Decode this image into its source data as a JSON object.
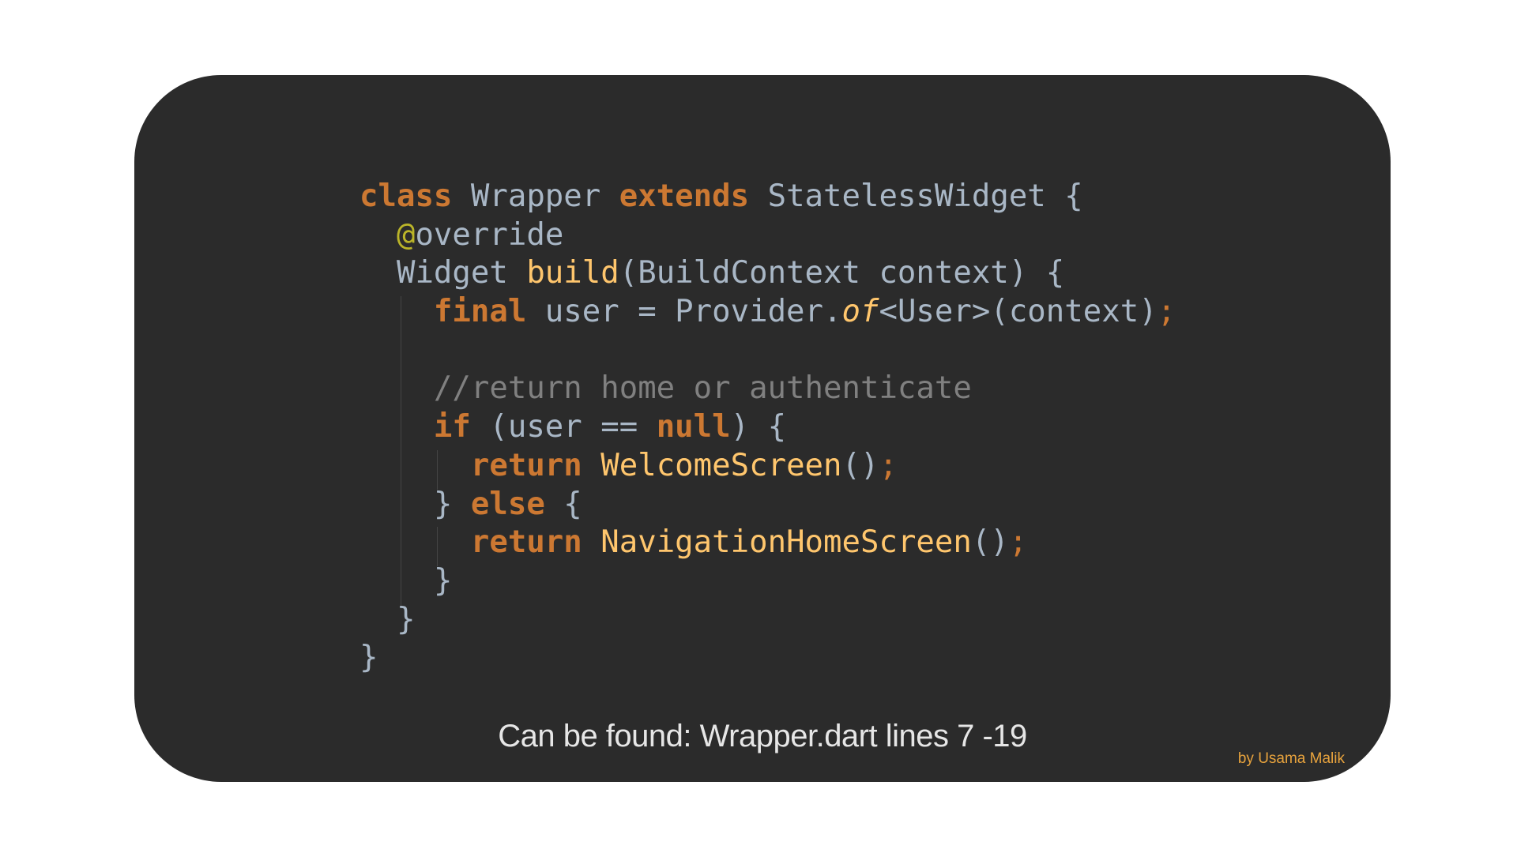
{
  "code": {
    "lines": [
      [
        {
          "t": "class",
          "c": "kw"
        },
        {
          "t": " Wrapper ",
          "c": ""
        },
        {
          "t": "extends",
          "c": "kw"
        },
        {
          "t": " StatelessWidget {",
          "c": ""
        }
      ],
      [
        {
          "t": "  ",
          "c": ""
        },
        {
          "t": "@",
          "c": "ann"
        },
        {
          "t": "override",
          "c": ""
        }
      ],
      [
        {
          "t": "  Widget ",
          "c": ""
        },
        {
          "t": "build",
          "c": "fn"
        },
        {
          "t": "(BuildContext context) {",
          "c": ""
        }
      ],
      [
        {
          "t": "    ",
          "c": ""
        },
        {
          "t": "final",
          "c": "kw"
        },
        {
          "t": " user = Provider.",
          "c": ""
        },
        {
          "t": "of",
          "c": "it"
        },
        {
          "t": "<User>(context)",
          "c": ""
        },
        {
          "t": ";",
          "c": "semi"
        }
      ],
      [
        {
          "t": "",
          "c": ""
        }
      ],
      [
        {
          "t": "    ",
          "c": ""
        },
        {
          "t": "//return home or authenticate",
          "c": "cm"
        }
      ],
      [
        {
          "t": "    ",
          "c": ""
        },
        {
          "t": "if",
          "c": "kw"
        },
        {
          "t": " (user == ",
          "c": ""
        },
        {
          "t": "null",
          "c": "kw"
        },
        {
          "t": ") {",
          "c": ""
        }
      ],
      [
        {
          "t": "      ",
          "c": ""
        },
        {
          "t": "return",
          "c": "kw"
        },
        {
          "t": " ",
          "c": ""
        },
        {
          "t": "WelcomeScreen",
          "c": "fn"
        },
        {
          "t": "()",
          "c": ""
        },
        {
          "t": ";",
          "c": "semi"
        }
      ],
      [
        {
          "t": "    } ",
          "c": ""
        },
        {
          "t": "else",
          "c": "kw"
        },
        {
          "t": " {",
          "c": ""
        }
      ],
      [
        {
          "t": "      ",
          "c": ""
        },
        {
          "t": "return",
          "c": "kw"
        },
        {
          "t": " ",
          "c": ""
        },
        {
          "t": "NavigationHomeScreen",
          "c": "fn"
        },
        {
          "t": "()",
          "c": ""
        },
        {
          "t": ";",
          "c": "semi"
        }
      ],
      [
        {
          "t": "    }",
          "c": ""
        }
      ],
      [
        {
          "t": "  }",
          "c": ""
        }
      ],
      [
        {
          "t": "}",
          "c": ""
        }
      ]
    ]
  },
  "caption": "Can be found: Wrapper.dart lines 7 -19",
  "credit": "by Usama Malik",
  "colors": {
    "background": "#2b2b2b",
    "keyword": "#cc7832",
    "function": "#ffc66d",
    "annotation": "#bbb529",
    "comment": "#808080",
    "text": "#a9b7c6",
    "credit": "#e8a33d"
  }
}
